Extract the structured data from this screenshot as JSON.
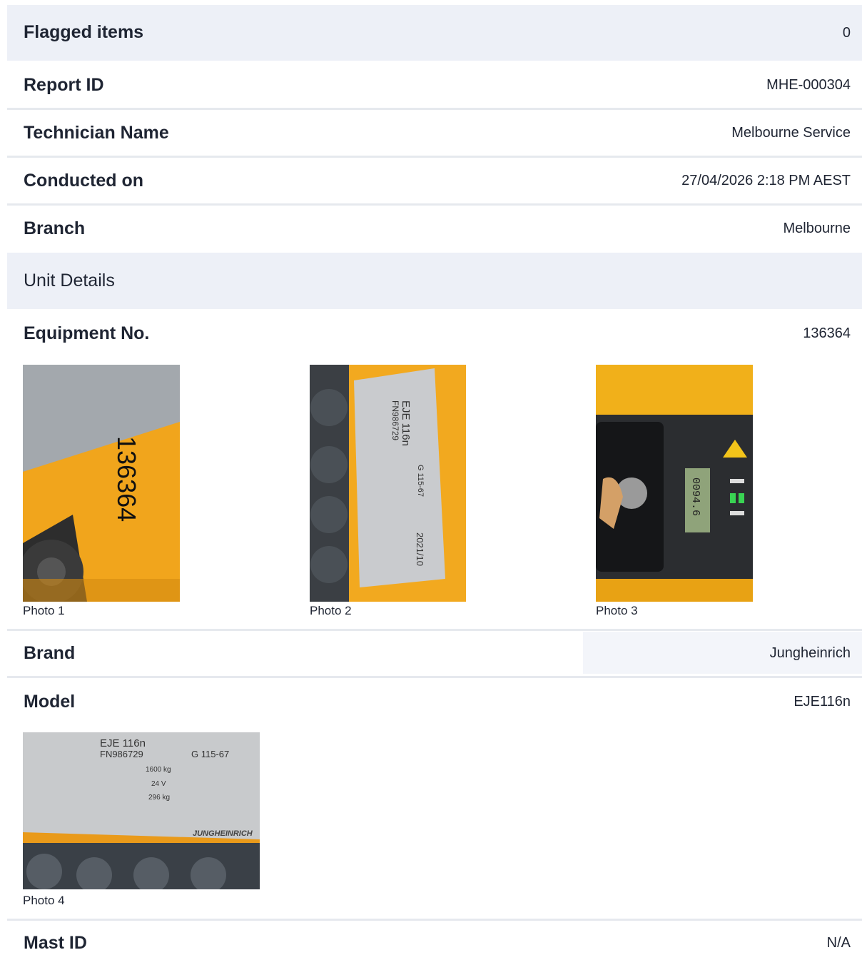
{
  "rows": {
    "flagged": {
      "label": "Flagged items",
      "value": "0"
    },
    "report_id": {
      "label": "Report ID",
      "value": "MHE-000304"
    },
    "technician": {
      "label": "Technician Name",
      "value": "Melbourne Service"
    },
    "conducted": {
      "label": "Conducted on",
      "value": "27/04/2026 2:18 PM AEST"
    },
    "branch": {
      "label": "Branch",
      "value": "Melbourne"
    },
    "equipment": {
      "label": "Equipment No.",
      "value": "136364"
    },
    "brand": {
      "label": "Brand",
      "value": "Jungheinrich"
    },
    "model": {
      "label": "Model",
      "value": "EJE116n"
    },
    "mast": {
      "label": "Mast ID",
      "value": "N/A"
    }
  },
  "section": {
    "unit_details": "Unit Details"
  },
  "photos": {
    "p1": {
      "caption": "Photo 1",
      "text": "136364"
    },
    "p2": {
      "caption": "Photo 2",
      "l1": "EJE 116n",
      "l2": "FN986729",
      "l3": "2021/10",
      "l4": "G 115-67"
    },
    "p3": {
      "caption": "Photo 3",
      "display": "0094.6"
    },
    "p4": {
      "caption": "Photo 4",
      "l1": "EJE 116n",
      "l2": "FN986729",
      "l3": "G 115-67",
      "l4": "1600 kg",
      "l5": "24 V",
      "l6": "296 kg",
      "l7": "JUNGHEINRICH"
    }
  },
  "colors": {
    "header_bg": "#edf0f7",
    "separator": "#e6e9ee",
    "text": "#1f2533",
    "machine_orange": "#f1a51c"
  }
}
